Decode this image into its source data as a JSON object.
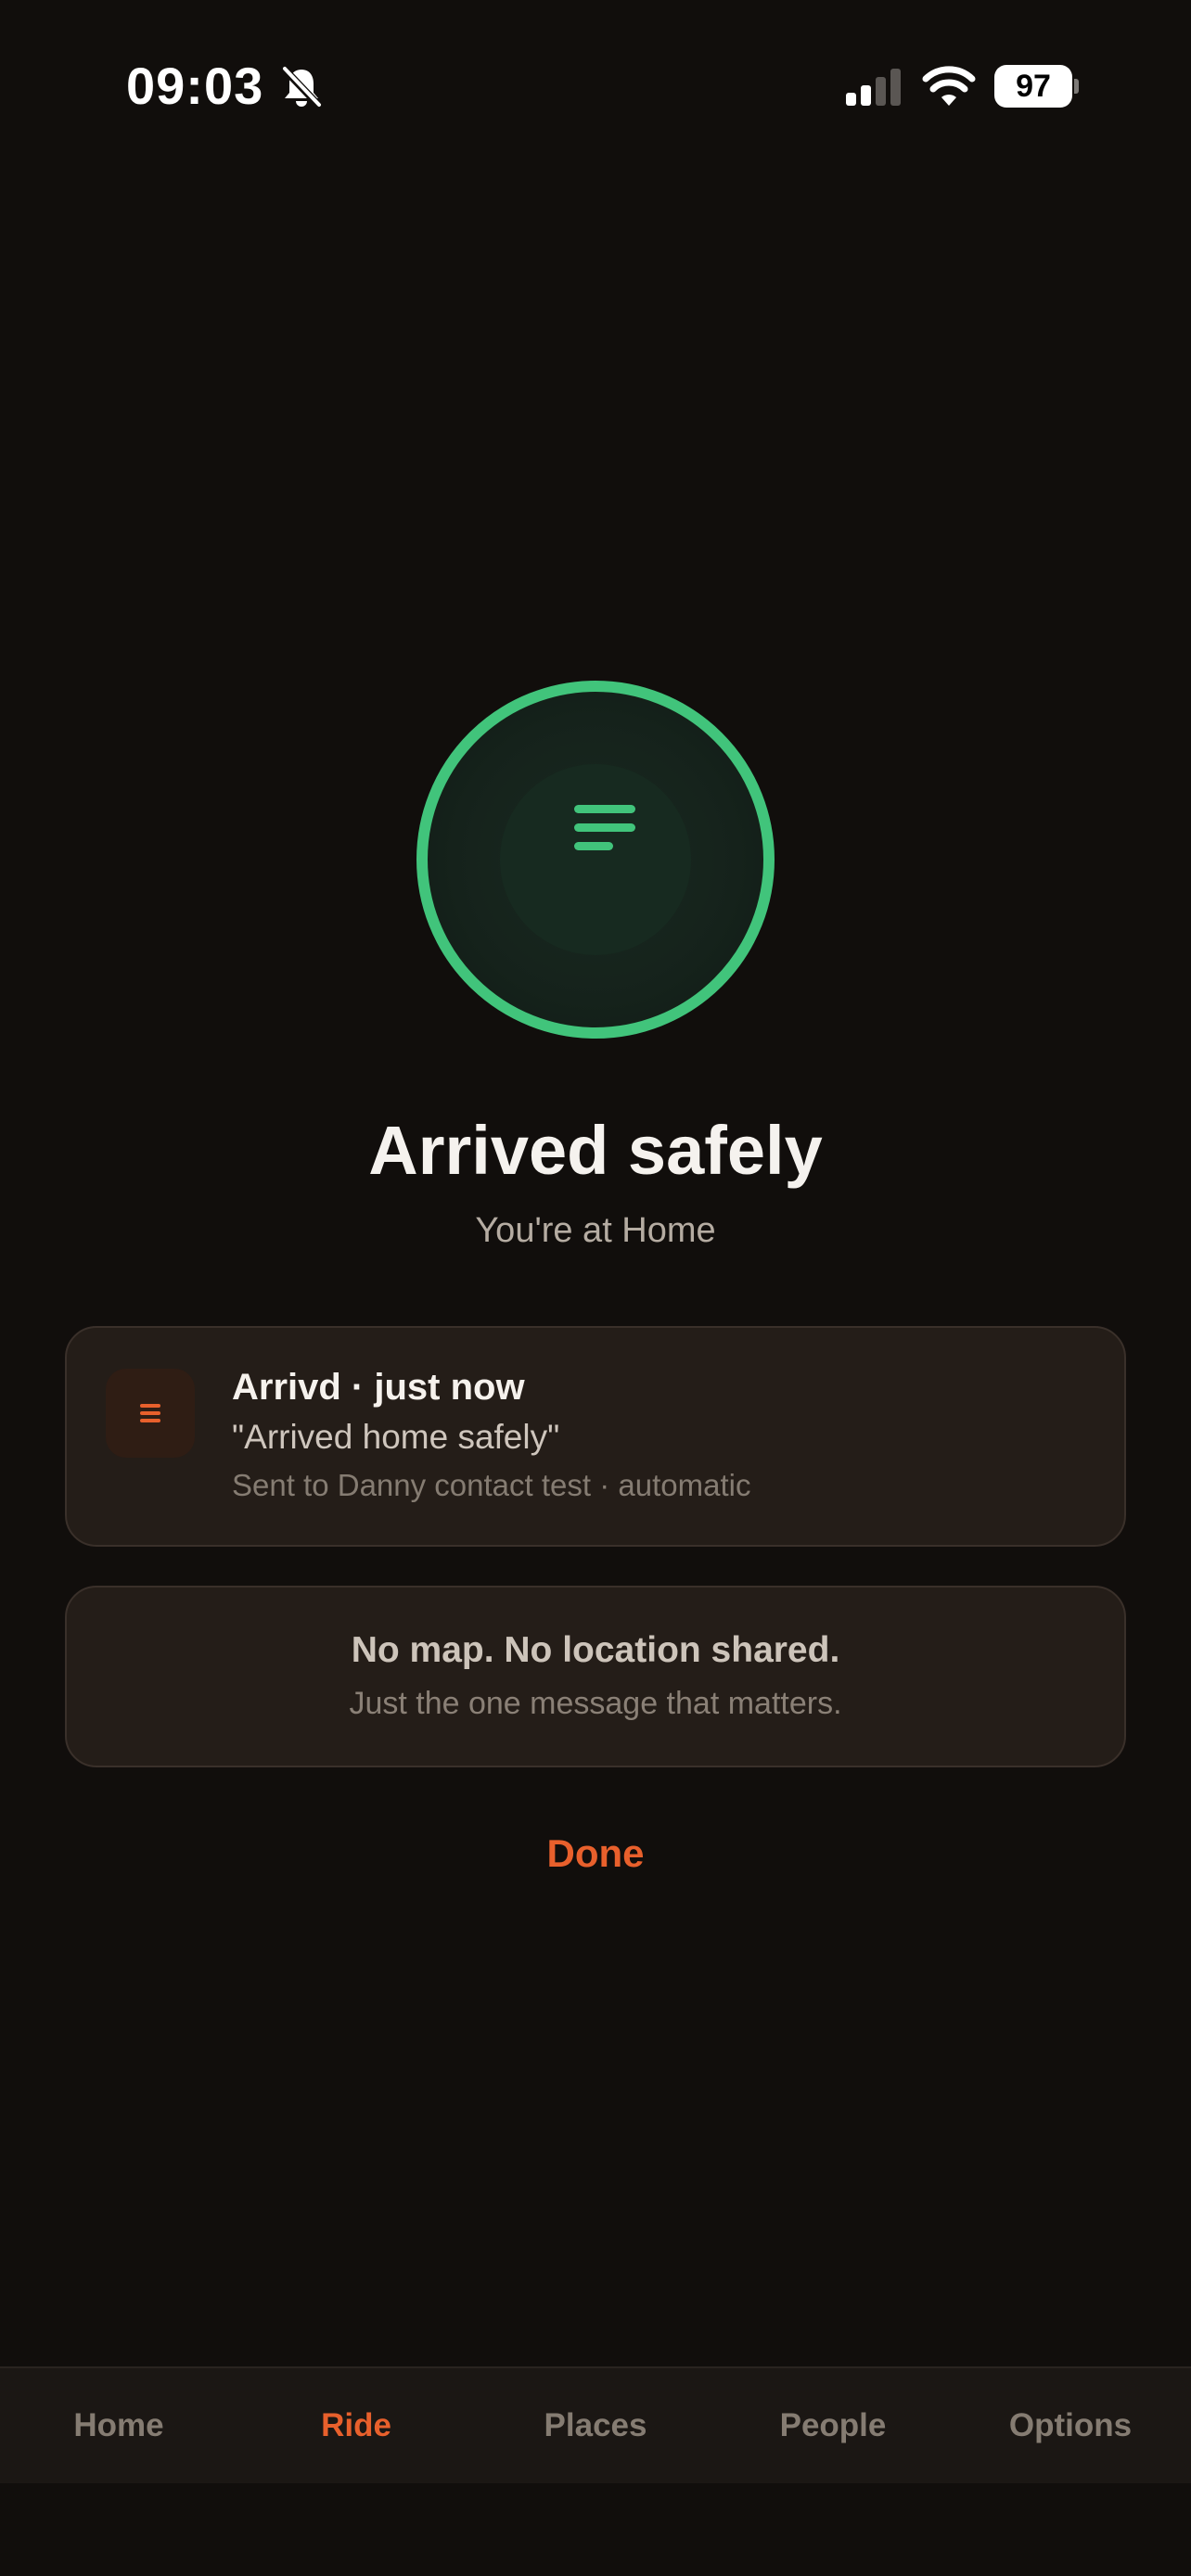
{
  "status_bar": {
    "time": "09:03",
    "battery": "97",
    "icons": [
      "bell-slash-icon",
      "cellular-signal-icon",
      "wifi-icon",
      "battery-icon"
    ]
  },
  "hero": {
    "icon": "message-lines-icon",
    "title": "Arrived safely",
    "subtitle": "You're at Home"
  },
  "notification": {
    "app_icon": "message-lines-icon",
    "header": "Arrivd · just now",
    "body": "\"Arrived home safely\"",
    "meta": "Sent to Danny contact test · automatic"
  },
  "info": {
    "title": "No map. No location shared.",
    "subtitle": "Just the one message that matters."
  },
  "done_label": "Done",
  "tab_bar": {
    "tabs": [
      {
        "label": "Home",
        "active": false
      },
      {
        "label": "Ride",
        "active": true
      },
      {
        "label": "Places",
        "active": false
      },
      {
        "label": "People",
        "active": false
      },
      {
        "label": "Options",
        "active": false
      }
    ]
  },
  "colors": {
    "background": "#110e0c",
    "success_green": "#41c47b",
    "accent_orange": "#e8602c",
    "card": "#241d18"
  }
}
